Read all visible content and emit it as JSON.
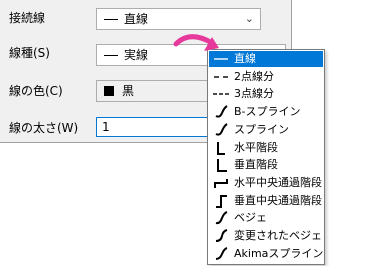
{
  "dialog": {
    "connect_label": "接続線",
    "connect_value": "直線",
    "linetype_label": "線種(S)",
    "linetype_value": "実線",
    "color_label": "線の色(C)",
    "color_value": "黒",
    "width_label": "線の太さ(W)",
    "width_value": "1"
  },
  "dropdown": {
    "selected_index": 0,
    "items": [
      {
        "label": "直線",
        "icon": "straight-line-icon"
      },
      {
        "label": "2点線分",
        "icon": "two-point-segment-icon"
      },
      {
        "label": "3点線分",
        "icon": "three-point-segment-icon"
      },
      {
        "label": "B-スプライン",
        "icon": "b-spline-icon"
      },
      {
        "label": "スプライン",
        "icon": "spline-icon"
      },
      {
        "label": "水平階段",
        "icon": "horizontal-step-icon"
      },
      {
        "label": "垂直階段",
        "icon": "vertical-step-icon"
      },
      {
        "label": "水平中央通過階段",
        "icon": "horizontal-center-step-icon"
      },
      {
        "label": "垂直中央通過階段",
        "icon": "vertical-center-step-icon"
      },
      {
        "label": "ベジェ",
        "icon": "bezier-icon"
      },
      {
        "label": "変更されたベジェ",
        "icon": "modified-bezier-icon"
      },
      {
        "label": "Akimaスプライン",
        "icon": "akima-spline-icon"
      }
    ]
  },
  "colors": {
    "selection": "#0078d7",
    "arrow": "#e6399b"
  }
}
